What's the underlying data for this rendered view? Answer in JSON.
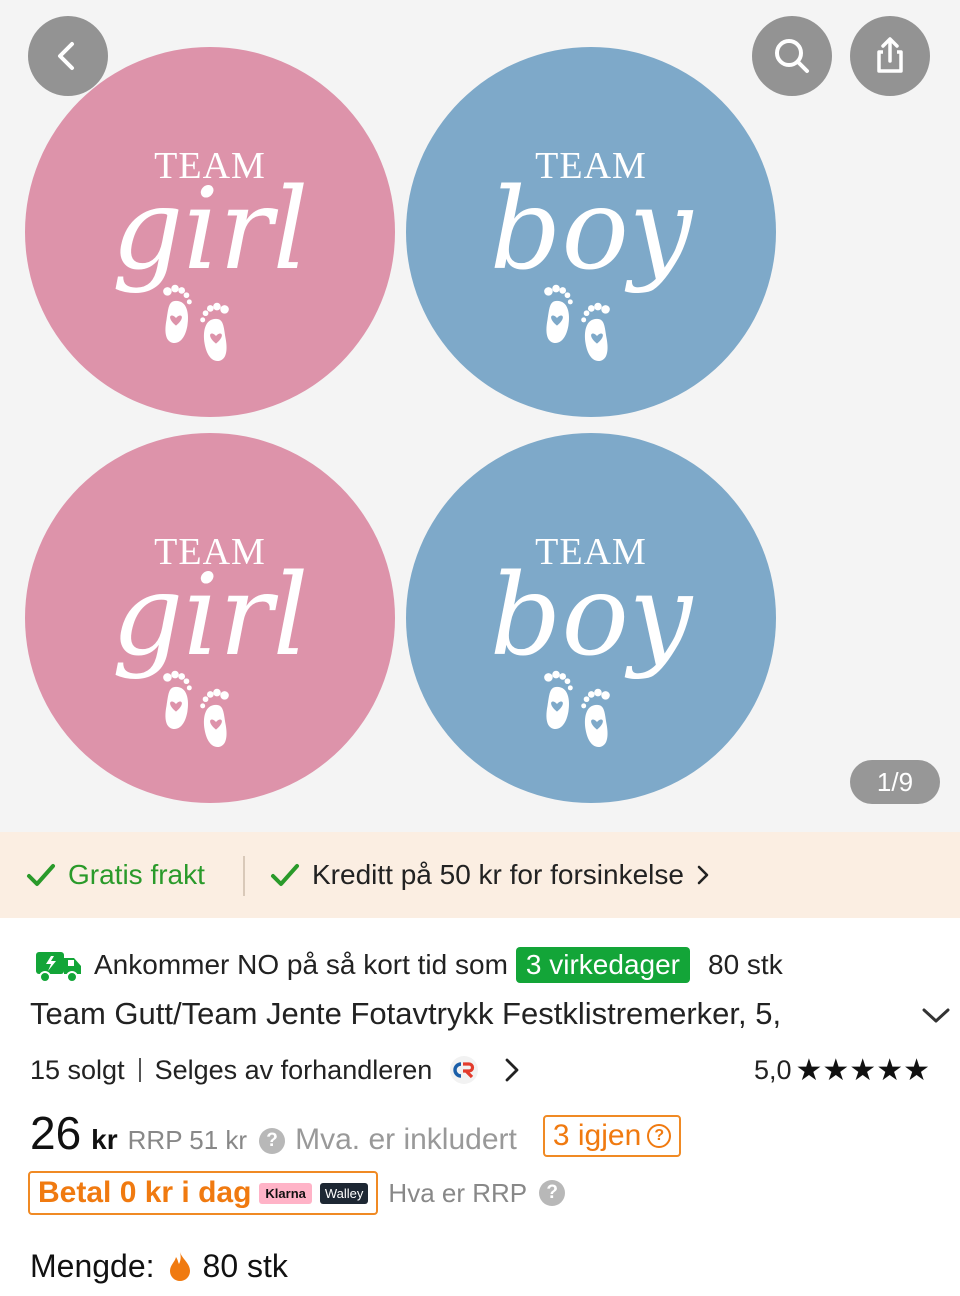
{
  "gallery": {
    "stickers": [
      {
        "team": "TEAM",
        "word": "girl",
        "color": "#dd93aa"
      },
      {
        "team": "TEAM",
        "word": "boy",
        "color": "#7ea9c9"
      },
      {
        "team": "TEAM",
        "word": "girl",
        "color": "#dd93aa"
      },
      {
        "team": "TEAM",
        "word": "boy",
        "color": "#7ea9c9"
      }
    ],
    "counter": "1/9",
    "icons": {
      "back": "chevron-left-icon",
      "search": "search-icon",
      "share": "share-icon"
    }
  },
  "benefits": {
    "free_shipping": "Gratis frakt",
    "delay_credit": "Kreditt på 50 kr for forsinkelse"
  },
  "arrival": {
    "text": "Ankommer NO på så kort tid som",
    "days_badge": "3 virkedager",
    "quantity": "80 stk"
  },
  "product": {
    "title": "Team Gutt/Team Jente Fotavtrykk Festklistremerker, 5,",
    "sold": "15 solgt",
    "seller": "Selges av forhandleren",
    "rating": "5,0",
    "stars": "★★★★★"
  },
  "price": {
    "amount": "26",
    "currency": "kr",
    "rrp": "RRP 51 kr",
    "vat": "Mva. er inkludert",
    "stock_left": "3 igjen"
  },
  "payment": {
    "pay_today": "Betal 0 kr i dag",
    "klarna": "Klarna",
    "walley": "Walley",
    "rrp_question": "Hva er RRP"
  },
  "quantity": {
    "label": "Mengde:",
    "value": "80 stk"
  },
  "colors": {
    "accent_orange": "#f07a10",
    "green": "#13a538",
    "benefit_bg": "#fbeee2"
  }
}
